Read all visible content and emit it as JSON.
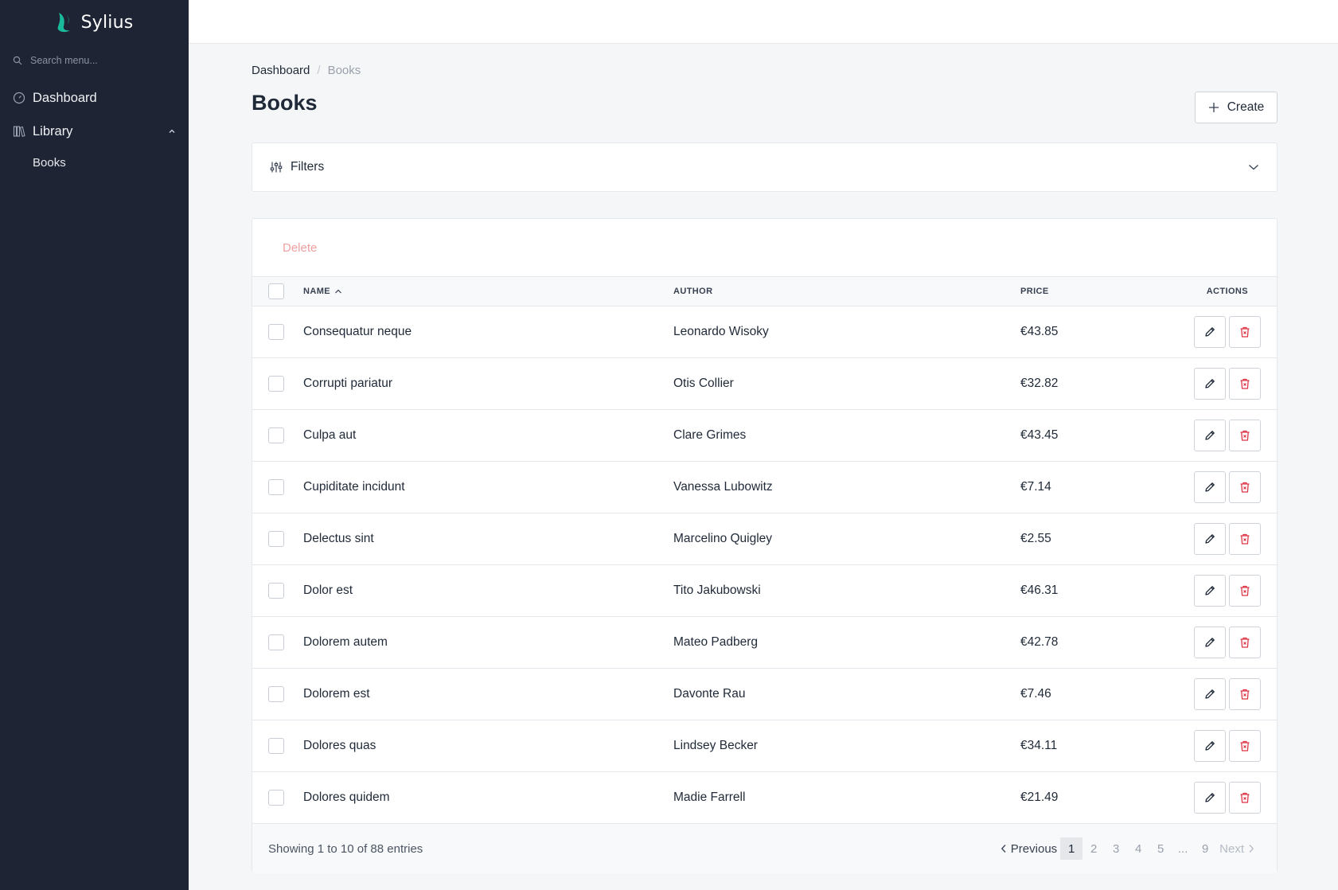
{
  "brand": {
    "name": "Sylius",
    "accent": "#1abb9c"
  },
  "sidebar": {
    "search_placeholder": "Search menu...",
    "items": [
      {
        "label": "Dashboard",
        "icon": "dashboard-icon"
      },
      {
        "label": "Library",
        "icon": "books-icon",
        "expanded": true,
        "children": [
          {
            "label": "Books"
          }
        ]
      }
    ]
  },
  "breadcrumb": {
    "home": "Dashboard",
    "separator": "/",
    "current": "Books"
  },
  "page": {
    "title": "Books",
    "create_label": "Create"
  },
  "filters": {
    "label": "Filters"
  },
  "bulk": {
    "delete_label": "Delete"
  },
  "table": {
    "columns": {
      "name": "NAME",
      "author": "AUTHOR",
      "price": "PRICE",
      "actions": "ACTIONS"
    },
    "sort": {
      "column": "name",
      "direction": "asc"
    },
    "rows": [
      {
        "name": "Consequatur neque",
        "author": "Leonardo Wisoky",
        "price": "€43.85"
      },
      {
        "name": "Corrupti pariatur",
        "author": "Otis Collier",
        "price": "€32.82"
      },
      {
        "name": "Culpa aut",
        "author": "Clare Grimes",
        "price": "€43.45"
      },
      {
        "name": "Cupiditate incidunt",
        "author": "Vanessa Lubowitz",
        "price": "€7.14"
      },
      {
        "name": "Delectus sint",
        "author": "Marcelino Quigley",
        "price": "€2.55"
      },
      {
        "name": "Dolor est",
        "author": "Tito Jakubowski",
        "price": "€46.31"
      },
      {
        "name": "Dolorem autem",
        "author": "Mateo Padberg",
        "price": "€42.78"
      },
      {
        "name": "Dolorem est",
        "author": "Davonte Rau",
        "price": "€7.46"
      },
      {
        "name": "Dolores quas",
        "author": "Lindsey Becker",
        "price": "€34.11"
      },
      {
        "name": "Dolores quidem",
        "author": "Madie Farrell",
        "price": "€21.49"
      }
    ]
  },
  "pagination": {
    "summary": "Showing 1 to 10 of 88 entries",
    "previous": "Previous",
    "next": "Next",
    "pages": [
      "1",
      "2",
      "3",
      "4",
      "5"
    ],
    "ellipsis": "...",
    "last": "9",
    "current": "1"
  },
  "colors": {
    "sidebar_bg": "#1e2433",
    "danger": "#dc3545",
    "delete_disabled": "#f0a0a0"
  }
}
